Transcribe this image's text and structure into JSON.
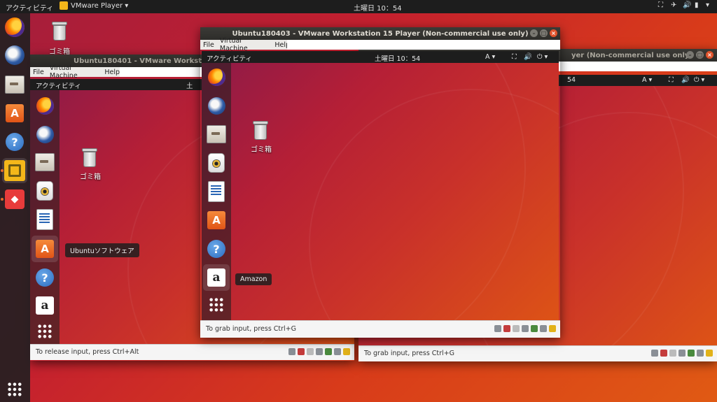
{
  "topbar": {
    "activities": "アクティビティ",
    "app_menu": "VMware Player",
    "clock": "土曜日 10：54"
  },
  "desktop": {
    "trash_label": "ゴミ箱"
  },
  "window_back": {
    "title": "Ubuntu180401 - VMware Workstation 15",
    "menu": [
      "File",
      "Virtual Machine",
      "Help"
    ],
    "guest": {
      "activities": "アクティビティ",
      "clock_partial": "土",
      "trash_label": "ゴミ箱"
    },
    "tooltip": "Ubuntuソフトウェア",
    "status": "To release input, press Ctrl+Alt"
  },
  "window_right": {
    "title_partial": "yer (Non-commercial use only)",
    "clock_partial": "54",
    "lang": "A",
    "status": "To grab input, press Ctrl+G"
  },
  "window_front": {
    "title": "Ubuntu180403 - VMware Workstation 15 Player (Non-commercial use only)",
    "menu": [
      "File",
      "Virtual Machine",
      "Help"
    ],
    "guest": {
      "activities": "アクティビティ",
      "clock": "土曜日 10：54",
      "lang": "A",
      "trash_label": "ゴミ箱"
    },
    "tooltip": "Amazon",
    "status": "To grab input, press Ctrl+G"
  },
  "colors": {
    "accent": "#e66b2a",
    "close": "#e0532c",
    "topbar": "#1d1d1d"
  }
}
